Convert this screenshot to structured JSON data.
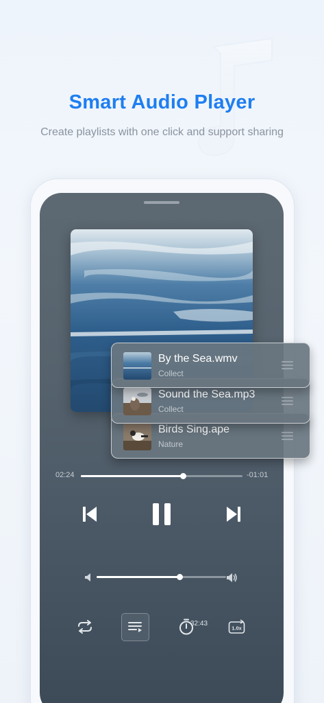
{
  "promo": {
    "title": "Smart Audio Player",
    "subtitle": "Create playlists with one click and support sharing"
  },
  "player": {
    "playlist": [
      {
        "title": "By the Sea.wmv",
        "category": "Collect",
        "thumb": "sea-thumbnail"
      },
      {
        "title": "Sound the Sea.mp3",
        "category": "Collect",
        "thumb": "seaside-bird-thumbnail"
      },
      {
        "title": "Birds Sing.ape",
        "category": "Nature",
        "thumb": "bird-thumbnail"
      }
    ],
    "progress": {
      "elapsed": "02:24",
      "remaining": "-01:01",
      "fraction": 0.63
    },
    "controls": {
      "previous_icon": "skip-previous-icon",
      "play_pause_icon": "pause-icon",
      "next_icon": "skip-next-icon"
    },
    "volume": {
      "fraction": 0.64
    },
    "bottom_bar": {
      "repeat_icon": "repeat-icon",
      "playlist_icon": "playlist-icon",
      "timer_icon": "sleep-timer-icon",
      "timer_value": "32:43",
      "speed_icon": "playback-speed-icon",
      "speed_value": "1.0x"
    }
  },
  "colors": {
    "accent": "#1e7ef0",
    "subtitle": "#8a939e",
    "screen_bg": "#56636e"
  }
}
